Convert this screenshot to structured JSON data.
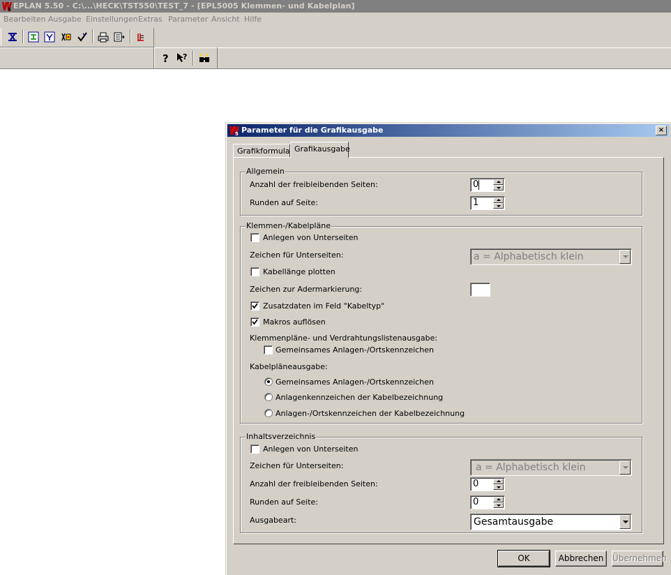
{
  "app": {
    "title": "EPLAN 5.50 - C:\\...\\HECK\\TST550\\TEST_7 - [EPL5005 Klemmen- und Kabelplan]",
    "logo_icon": "eplan-logo-icon"
  },
  "menu": {
    "items": [
      "Bearbeiten",
      "Ausgabe",
      "Einstellungen",
      "Extras",
      "Parameter",
      "Ansicht",
      "Hilfe"
    ]
  },
  "toolbar": {
    "icons": [
      "terminal-icon",
      "schematic-icon",
      "filter-icon",
      "connection-icon",
      "check-icon",
      "print-icon",
      "export-icon",
      "list-icon",
      "help-icon",
      "context-help-icon",
      "search-icon"
    ]
  },
  "dialog": {
    "title": "Parameter für die Grafikausgabe",
    "close_label": "×",
    "tabs": [
      {
        "label": "Grafikformulare",
        "active": false
      },
      {
        "label": "Grafikausgabe",
        "active": true
      }
    ],
    "allgemein": {
      "title": "Allgemein",
      "free_pages_label": "Anzahl der freibleibenden Seiten:",
      "free_pages_value": "0",
      "round_label": "Runden auf Seite:",
      "round_value": "1"
    },
    "klemmen": {
      "title": "Klemmen-/Kabelpläne",
      "subpages_label": "Anlegen von Unterseiten",
      "subpages_checked": false,
      "subpage_char_label": "Zeichen für Unterseiten:",
      "subpage_char_value": "a = Alphabetisch klein",
      "cable_length_label": "Kabellänge plotten",
      "cable_length_checked": false,
      "core_marking_label": "Zeichen zur Adermarkierung:",
      "core_marking_value": "",
      "extra_data_label": "Zusatzdaten im Feld \"Kabeltyp\"",
      "extra_data_checked": true,
      "macros_label": "Makros auflösen",
      "macros_checked": true,
      "terminal_output_label": "Klemmenpläne- und Verdrahtungslistenausgabe:",
      "common_code_label": "Gemeinsames Anlagen-/Ortskennzeichen",
      "common_code_checked": false,
      "cable_output_label": "Kabelpläneausgabe:",
      "radios": [
        {
          "label": "Gemeinsames Anlagen-/Ortskennzeichen",
          "selected": true
        },
        {
          "label": "Anlagenkennzeichen der Kabelbezeichnung",
          "selected": false
        },
        {
          "label": "Anlagen-/Ortskennzeichen der Kabelbezeichnung",
          "selected": false
        }
      ]
    },
    "inhalt": {
      "title": "Inhaltsverzeichnis",
      "subpages_label": "Anlegen von Unterseiten",
      "subpages_checked": false,
      "subpage_char_label": "Zeichen für Unterseiten:",
      "subpage_char_value": "a = Alphabetisch klein",
      "free_pages_label": "Anzahl der freibleibenden Seiten:",
      "free_pages_value": "0",
      "round_label": "Runden auf Seite:",
      "round_value": "0",
      "output_type_label": "Ausgabeart:",
      "output_type_value": "Gesamtausgabe"
    },
    "buttons": {
      "ok": "OK",
      "cancel": "Abbrechen",
      "apply": "Übernehmen"
    }
  }
}
